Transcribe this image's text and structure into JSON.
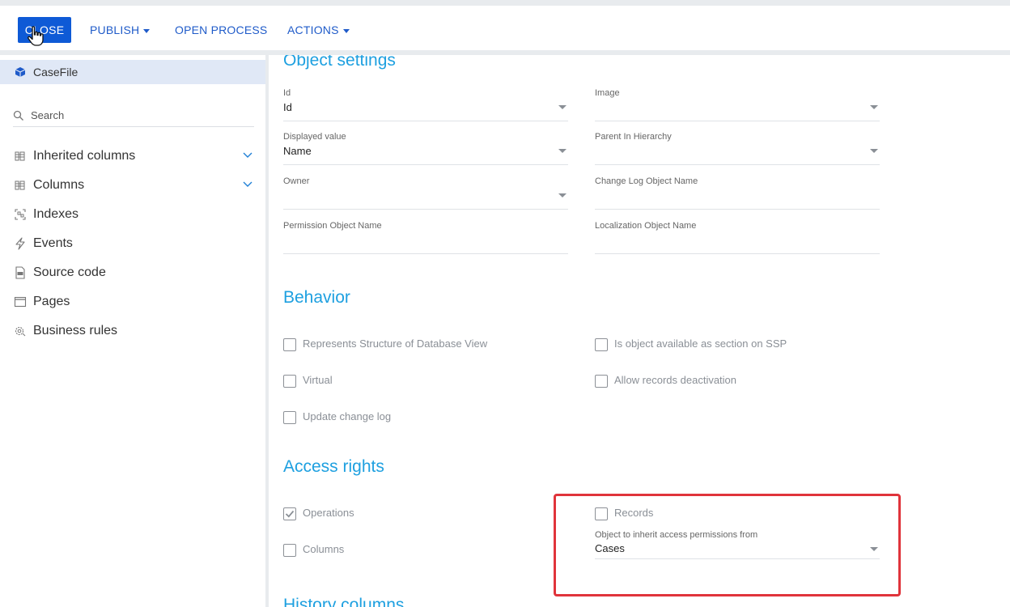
{
  "toolbar": {
    "close_label": "CLOSE",
    "publish_label": "PUBLISH",
    "open_process_label": "OPEN PROCESS",
    "actions_label": "ACTIONS"
  },
  "sidebar": {
    "selected": {
      "label": "CaseFile",
      "icon": "cube-icon"
    },
    "search": {
      "placeholder": "Search"
    },
    "items": [
      {
        "label": "Inherited columns",
        "icon": "columns-list-icon",
        "expandable": true
      },
      {
        "label": "Columns",
        "icon": "columns-list-icon",
        "expandable": true
      },
      {
        "label": "Indexes",
        "icon": "index-icon",
        "expandable": false
      },
      {
        "label": "Events",
        "icon": "lightning-icon",
        "expandable": false
      },
      {
        "label": "Source code",
        "icon": "code-file-icon",
        "expandable": false
      },
      {
        "label": "Pages",
        "icon": "window-icon",
        "expandable": false
      },
      {
        "label": "Business rules",
        "icon": "gear-icon",
        "expandable": false
      }
    ]
  },
  "object_settings": {
    "title": "Object settings",
    "fields": [
      {
        "label": "Id",
        "value": "Id",
        "dropdown": true
      },
      {
        "label": "Image",
        "value": "",
        "dropdown": true
      },
      {
        "label": "Displayed value",
        "value": "Name",
        "dropdown": true
      },
      {
        "label": "Parent In Hierarchy",
        "value": "",
        "dropdown": true
      },
      {
        "label": "Owner",
        "value": "",
        "dropdown": true
      },
      {
        "label": "Change Log Object Name",
        "value": "",
        "dropdown": false
      },
      {
        "label": "Permission Object Name",
        "value": "",
        "dropdown": false
      },
      {
        "label": "Localization Object Name",
        "value": "",
        "dropdown": false
      }
    ]
  },
  "behavior": {
    "title": "Behavior",
    "checkboxes": [
      {
        "label": "Represents Structure of Database View",
        "checked": false
      },
      {
        "label": "Is object available as section on SSP",
        "checked": false
      },
      {
        "label": "Virtual",
        "checked": false
      },
      {
        "label": "Allow records deactivation",
        "checked": false
      },
      {
        "label": "Update change log",
        "checked": false
      }
    ]
  },
  "access_rights": {
    "title": "Access rights",
    "operations": {
      "label": "Operations",
      "checked": true
    },
    "records": {
      "label": "Records",
      "checked": false
    },
    "columns": {
      "label": "Columns",
      "checked": false
    },
    "inherit_field": {
      "label": "Object to inherit access permissions from",
      "value": "Cases"
    }
  },
  "history_columns": {
    "title": "History columns"
  },
  "colors": {
    "accent": "#0e5ad6",
    "section_title": "#1ea0e0",
    "highlight": "#e0343b"
  }
}
